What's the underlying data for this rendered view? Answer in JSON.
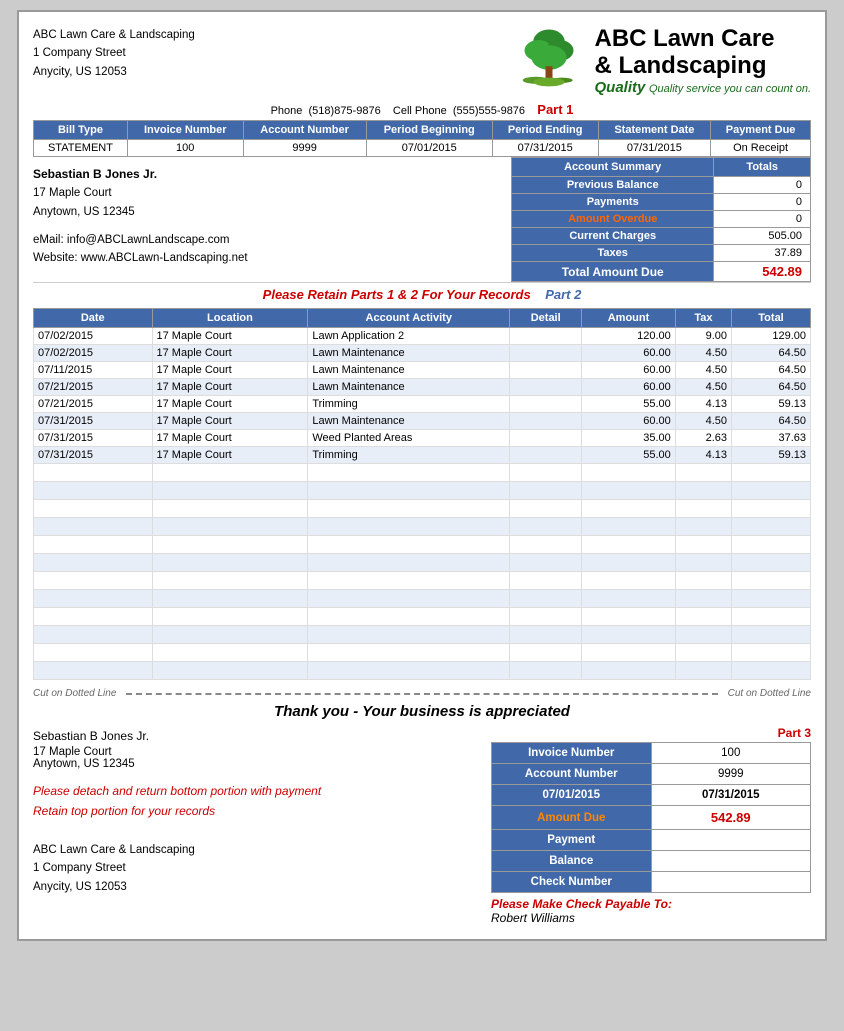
{
  "company": {
    "name": "ABC Lawn Care & Landscaping",
    "address1": "1 Company Street",
    "address2": "Anycity, US  12053",
    "phone": "(518)875-9876",
    "cell": "(555)555-9876",
    "email": "info@ABCLawnLandscape.com",
    "website": "www.ABCLawn-Landscaping.net",
    "logo_title1": "ABC Lawn Care",
    "logo_title2": "& Landscaping",
    "tagline": "Quality service you can count on."
  },
  "invoice": {
    "bill_type": "STATEMENT",
    "invoice_number": "100",
    "account_number": "9999",
    "period_beginning": "07/01/2015",
    "period_ending": "07/31/2015",
    "statement_date": "07/31/2015",
    "payment_due": "On Receipt"
  },
  "customer": {
    "name": "Sebastian B Jones Jr.",
    "address1": "17 Maple Court",
    "address2": "Anytown, US  12345"
  },
  "summary": {
    "title": "Account Summary",
    "totals_label": "Totals",
    "previous_balance_label": "Previous Balance",
    "previous_balance_value": "0",
    "payments_label": "Payments",
    "payments_value": "0",
    "amount_overdue_label": "Amount Overdue",
    "amount_overdue_value": "0",
    "current_charges_label": "Current Charges",
    "current_charges_value": "505.00",
    "taxes_label": "Taxes",
    "taxes_value": "37.89",
    "total_label": "Total Amount Due",
    "total_value": "542.89"
  },
  "retain_msg": "Please Retain Parts 1 & 2 For Your Records",
  "part_labels": {
    "part1": "Part 1",
    "part2": "Part 2",
    "part3": "Part 3"
  },
  "activity_headers": [
    "Date",
    "Location",
    "Account Activity",
    "Detail",
    "Amount",
    "Tax",
    "Total"
  ],
  "activity_rows": [
    {
      "date": "07/02/2015",
      "location": "17 Maple Court",
      "activity": "Lawn Application 2",
      "detail": "",
      "amount": "120.00",
      "tax": "9.00",
      "total": "129.00"
    },
    {
      "date": "07/02/2015",
      "location": "17 Maple Court",
      "activity": "Lawn Maintenance",
      "detail": "",
      "amount": "60.00",
      "tax": "4.50",
      "total": "64.50"
    },
    {
      "date": "07/11/2015",
      "location": "17 Maple Court",
      "activity": "Lawn Maintenance",
      "detail": "",
      "amount": "60.00",
      "tax": "4.50",
      "total": "64.50"
    },
    {
      "date": "07/21/2015",
      "location": "17 Maple Court",
      "activity": "Lawn Maintenance",
      "detail": "",
      "amount": "60.00",
      "tax": "4.50",
      "total": "64.50"
    },
    {
      "date": "07/21/2015",
      "location": "17 Maple Court",
      "activity": "Trimming",
      "detail": "",
      "amount": "55.00",
      "tax": "4.13",
      "total": "59.13"
    },
    {
      "date": "07/31/2015",
      "location": "17 Maple Court",
      "activity": "Lawn Maintenance",
      "detail": "",
      "amount": "60.00",
      "tax": "4.50",
      "total": "64.50"
    },
    {
      "date": "07/31/2015",
      "location": "17 Maple Court",
      "activity": "Weed Planted Areas",
      "detail": "",
      "amount": "35.00",
      "tax": "2.63",
      "total": "37.63"
    },
    {
      "date": "07/31/2015",
      "location": "17 Maple Court",
      "activity": "Trimming",
      "detail": "",
      "amount": "55.00",
      "tax": "4.13",
      "total": "59.13"
    }
  ],
  "cut_text": "Cut on Dotted Line",
  "thank_you": "Thank you - Your business is appreciated",
  "bottom": {
    "instructions_line1": "Please detach and return bottom portion with payment",
    "instructions_line2": "Retain top portion for your records"
  },
  "payment_table": {
    "invoice_number_label": "Invoice Number",
    "invoice_number_value": "100",
    "account_number_label": "Account Number",
    "account_number_value": "9999",
    "period_beginning": "07/01/2015",
    "period_ending": "07/31/2015",
    "amount_due_label": "Amount Due",
    "amount_due_value": "542.89",
    "payment_label": "Payment",
    "payment_value": "",
    "balance_label": "Balance",
    "balance_value": "",
    "check_number_label": "Check Number",
    "check_number_value": ""
  },
  "payable": {
    "title": "Please Make Check Payable To:",
    "name": "Robert Williams"
  },
  "billing_headers": {
    "bill_type": "Bill Type",
    "invoice_number": "Invoice Number",
    "account_number": "Account Number",
    "period_beginning": "Period Beginning",
    "period_ending": "Period Ending",
    "statement_date": "Statement Date",
    "payment_due": "Payment Due"
  },
  "phone_label": "Phone",
  "cell_label": "Cell Phone",
  "email_label": "eMail:",
  "website_label": "Website:"
}
